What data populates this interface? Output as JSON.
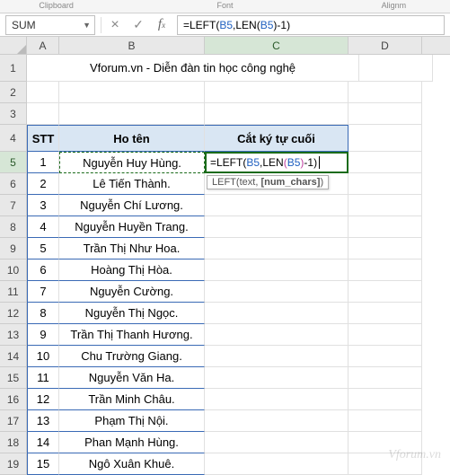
{
  "ribbon": {
    "clipboard": "Clipboard",
    "font": "Font",
    "align": "Alignm"
  },
  "nameBox": "SUM",
  "formula": {
    "prefix": "=LEFT(",
    "arg1": "B5",
    "mid": ",LEN(",
    "arg2": "B5",
    "suffix": ")-1)",
    "raw": "=LEFT(B5,LEN(B5)-1)"
  },
  "tooltip": {
    "fn": "LEFT",
    "p1": "text",
    "p2": "[num_chars]"
  },
  "columns": [
    "A",
    "B",
    "C",
    "D"
  ],
  "title": "Vforum.vn - Diễn đàn tin học công nghệ",
  "headers": {
    "a": "STT",
    "b": "Ho tên",
    "c": "Cắt ký tự cuối"
  },
  "rows": [
    {
      "n": "1",
      "name": "Nguyễn Huy Hùng."
    },
    {
      "n": "2",
      "name": "Lê Tiến Thành."
    },
    {
      "n": "3",
      "name": "Nguyễn Chí Lương."
    },
    {
      "n": "4",
      "name": "Nguyễn Huyền Trang."
    },
    {
      "n": "5",
      "name": "Trần Thị Như Hoa."
    },
    {
      "n": "6",
      "name": "Hoàng Thị Hòa."
    },
    {
      "n": "7",
      "name": "Nguyễn  Cường."
    },
    {
      "n": "8",
      "name": "Nguyễn Thị Ngọc."
    },
    {
      "n": "9",
      "name": "Trần Thị Thanh Hương."
    },
    {
      "n": "10",
      "name": "Chu Trường Giang."
    },
    {
      "n": "11",
      "name": "Nguyễn Văn Ha."
    },
    {
      "n": "12",
      "name": "Trần Minh Châu."
    },
    {
      "n": "13",
      "name": "Phạm Thị Nội."
    },
    {
      "n": "14",
      "name": "Phan Mạnh Hùng."
    },
    {
      "n": "15",
      "name": "Ngô  Xuân Khuê."
    }
  ],
  "rowNums": [
    "1",
    "2",
    "3",
    "4",
    "5",
    "6",
    "7",
    "8",
    "9",
    "10",
    "11",
    "12",
    "13",
    "14",
    "15",
    "16",
    "17",
    "18",
    "19"
  ],
  "watermark": "Vforum.vn"
}
